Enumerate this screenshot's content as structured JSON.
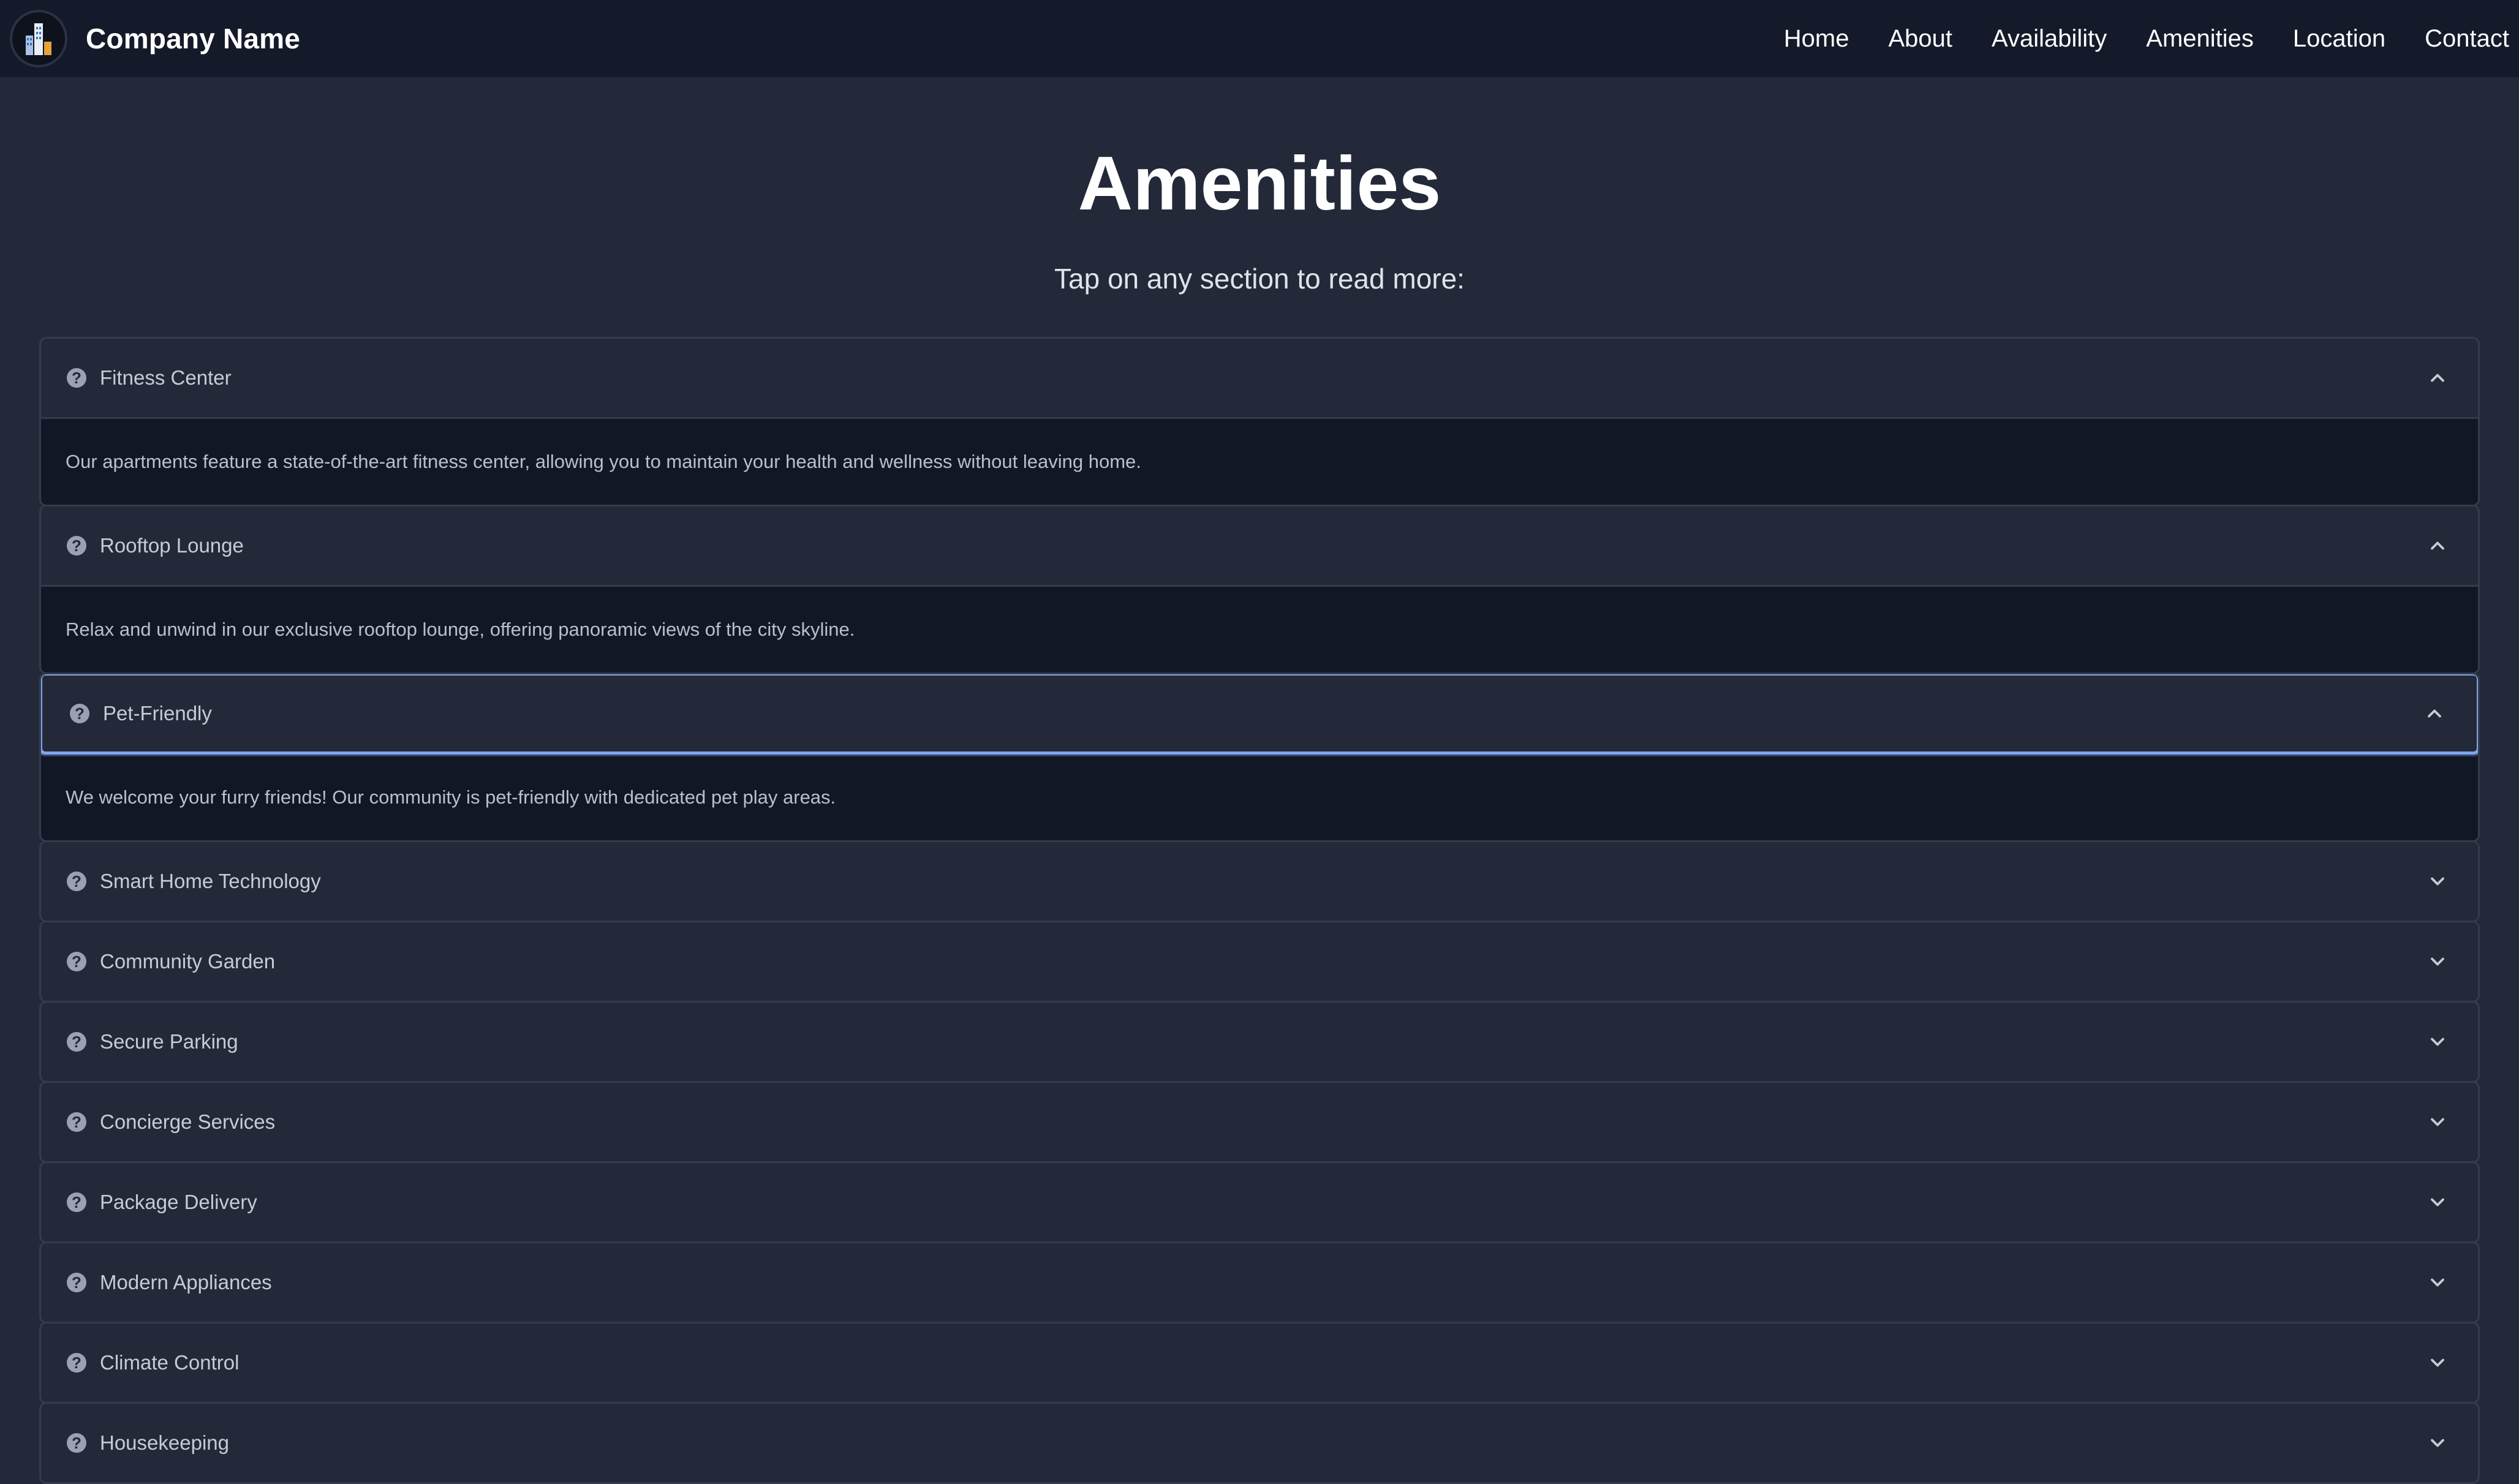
{
  "nav": {
    "brand": "Company Name",
    "logo_icon": "building-logo-icon",
    "links": [
      "Home",
      "About",
      "Availability",
      "Amenities",
      "Location",
      "Contact"
    ]
  },
  "page": {
    "title": "Amenities",
    "subtitle": "Tap on any section to read more:"
  },
  "accordion": [
    {
      "label": "Fitness Center",
      "expanded": true,
      "content": "Our apartments feature a state-of-the-art fitness center, allowing you to maintain your health and wellness without leaving home."
    },
    {
      "label": "Rooftop Lounge",
      "expanded": true,
      "content": "Relax and unwind in our exclusive rooftop lounge, offering panoramic views of the city skyline."
    },
    {
      "label": "Pet-Friendly",
      "expanded": true,
      "focused": true,
      "content": "We welcome your furry friends! Our community is pet-friendly with dedicated pet play areas."
    },
    {
      "label": "Smart Home Technology",
      "expanded": false
    },
    {
      "label": "Community Garden",
      "expanded": false
    },
    {
      "label": "Secure Parking",
      "expanded": false
    },
    {
      "label": "Concierge Services",
      "expanded": false
    },
    {
      "label": "Package Delivery",
      "expanded": false
    },
    {
      "label": "Modern Appliances",
      "expanded": false
    },
    {
      "label": "Climate Control",
      "expanded": false
    },
    {
      "label": "Housekeeping",
      "expanded": false
    }
  ],
  "colors": {
    "navbar_bg": "#141a29",
    "page_bg": "#232938",
    "panel_bg": "#121726",
    "focus_ring": "#7fa6ef"
  }
}
